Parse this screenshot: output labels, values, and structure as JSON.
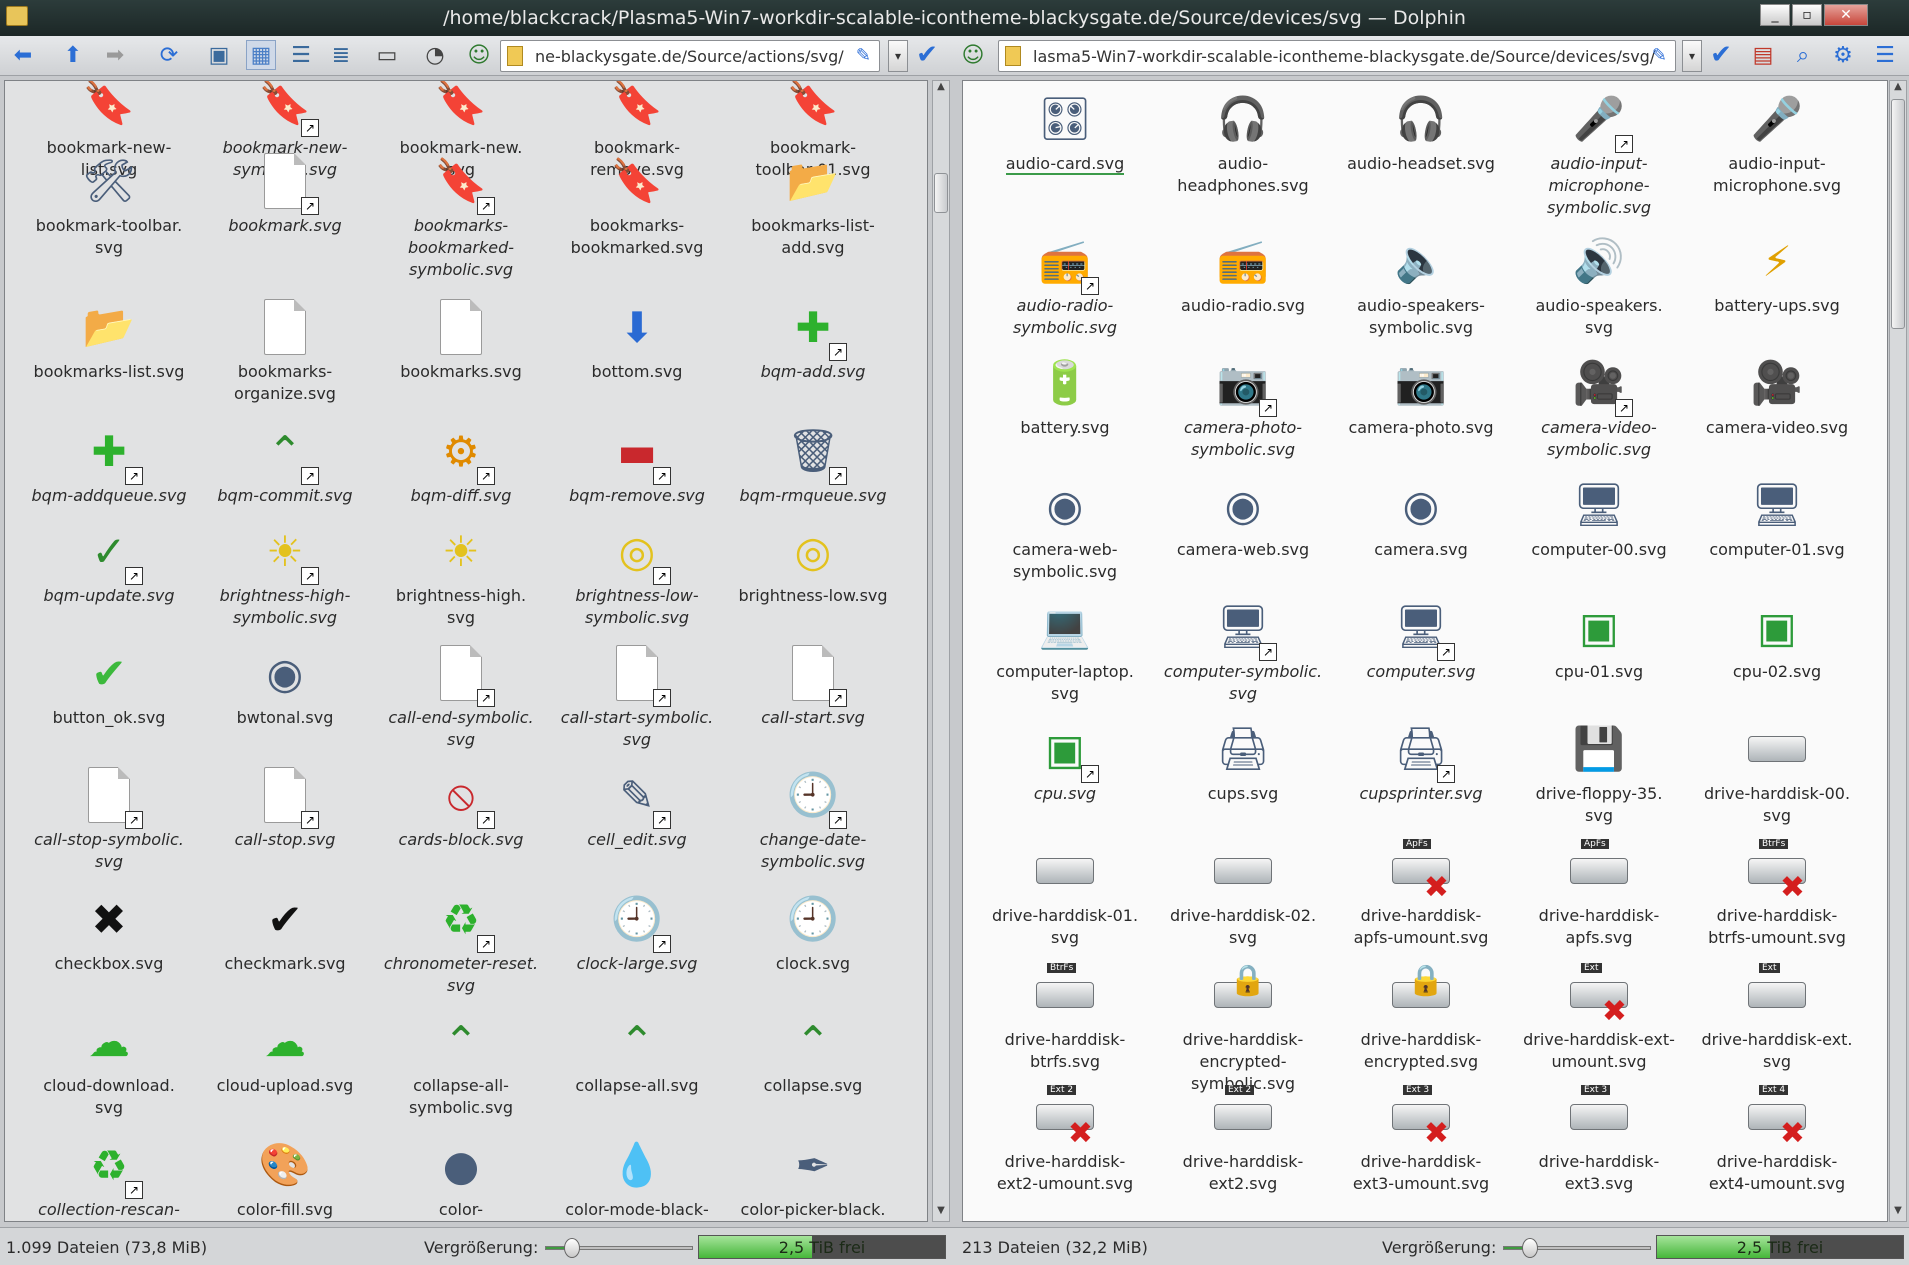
{
  "window": {
    "title": "/home/blackcrack/Plasma5-Win7-workdir-scalable-icontheme-blackysgate.de/Source/devices/svg — Dolphin",
    "buttons": [
      "_",
      "▫",
      "✕"
    ]
  },
  "toolbar": {
    "left_path": "ne-blackysgate.de/Source/actions/svg/",
    "right_path": "lasma5-Win7-workdir-scalable-icontheme-blackysgate.de/Source/devices/svg/"
  },
  "left_pane": {
    "items": [
      {
        "label": "bookmark-new-\nlist.svg",
        "icon": "bookmark-new-list-icon",
        "link": false
      },
      {
        "label": "bookmark-new-\nsymbolic.svg",
        "icon": "bookmark-new-symbolic-icon",
        "link": true
      },
      {
        "label": "bookmark-new.\nsvg",
        "icon": "bookmark-new-icon",
        "link": false
      },
      {
        "label": "bookmark-\nremove.svg",
        "icon": "bookmark-remove-icon",
        "link": false
      },
      {
        "label": "bookmark-\ntoolbar-01.svg",
        "icon": "bookmark-toolbar-icon",
        "link": false
      },
      {
        "label": "bookmark-toolbar.\nsvg",
        "icon": "bookmark-toolbar-tools-icon",
        "link": false
      },
      {
        "label": "bookmark.svg",
        "icon": "bookmark-icon",
        "link": true
      },
      {
        "label": "bookmarks-\nbookmarked-\nsymbolic.svg",
        "icon": "bookmarks-bookmarked-symbolic-icon",
        "link": true
      },
      {
        "label": "bookmarks-\nbookmarked.svg",
        "icon": "bookmarks-bookmarked-icon",
        "link": false
      },
      {
        "label": "bookmarks-list-\nadd.svg",
        "icon": "bookmarks-list-add-icon",
        "link": false
      },
      {
        "label": "bookmarks-list.svg",
        "icon": "bookmarks-list-icon",
        "link": false
      },
      {
        "label": "bookmarks-\norganize.svg",
        "icon": "bookmarks-organize-icon",
        "link": false
      },
      {
        "label": "bookmarks.svg",
        "icon": "bookmarks-icon",
        "link": false
      },
      {
        "label": "bottom.svg",
        "icon": "bottom-icon",
        "link": false
      },
      {
        "label": "bqm-add.svg",
        "icon": "bqm-add-icon",
        "link": true
      },
      {
        "label": "bqm-addqueue.svg",
        "icon": "bqm-addqueue-icon",
        "link": true
      },
      {
        "label": "bqm-commit.svg",
        "icon": "bqm-commit-icon",
        "link": true
      },
      {
        "label": "bqm-diff.svg",
        "icon": "bqm-diff-icon",
        "link": true
      },
      {
        "label": "bqm-remove.svg",
        "icon": "bqm-remove-icon",
        "link": true
      },
      {
        "label": "bqm-rmqueue.svg",
        "icon": "bqm-rmqueue-icon",
        "link": true
      },
      {
        "label": "bqm-update.svg",
        "icon": "bqm-update-icon",
        "link": true
      },
      {
        "label": "brightness-high-\nsymbolic.svg",
        "icon": "brightness-high-symbolic-icon",
        "link": true
      },
      {
        "label": "brightness-high.\nsvg",
        "icon": "brightness-high-icon",
        "link": false
      },
      {
        "label": "brightness-low-\nsymbolic.svg",
        "icon": "brightness-low-symbolic-icon",
        "link": true
      },
      {
        "label": "brightness-low.svg",
        "icon": "brightness-low-icon",
        "link": false
      },
      {
        "label": "button_ok.svg",
        "icon": "button-ok-icon",
        "link": false
      },
      {
        "label": "bwtonal.svg",
        "icon": "bwtonal-icon",
        "link": false
      },
      {
        "label": "call-end-symbolic.\nsvg",
        "icon": "call-end-symbolic-icon",
        "link": true
      },
      {
        "label": "call-start-symbolic.\nsvg",
        "icon": "call-start-symbolic-icon",
        "link": true
      },
      {
        "label": "call-start.svg",
        "icon": "call-start-icon",
        "link": true
      },
      {
        "label": "call-stop-symbolic.\nsvg",
        "icon": "call-stop-symbolic-icon",
        "link": true
      },
      {
        "label": "call-stop.svg",
        "icon": "call-stop-icon",
        "link": true
      },
      {
        "label": "cards-block.svg",
        "icon": "cards-block-icon",
        "link": true
      },
      {
        "label": "cell_edit.svg",
        "icon": "cell-edit-icon",
        "link": true
      },
      {
        "label": "change-date-\nsymbolic.svg",
        "icon": "change-date-symbolic-icon",
        "link": true
      },
      {
        "label": "checkbox.svg",
        "icon": "checkbox-icon",
        "link": false
      },
      {
        "label": "checkmark.svg",
        "icon": "checkmark-icon",
        "link": false
      },
      {
        "label": "chronometer-reset.\nsvg",
        "icon": "chronometer-reset-icon",
        "link": true
      },
      {
        "label": "clock-large.svg",
        "icon": "clock-large-icon",
        "link": true
      },
      {
        "label": "clock.svg",
        "icon": "clock-icon",
        "link": false
      },
      {
        "label": "cloud-download.\nsvg",
        "icon": "cloud-download-icon",
        "link": false
      },
      {
        "label": "cloud-upload.svg",
        "icon": "cloud-upload-icon",
        "link": false
      },
      {
        "label": "collapse-all-\nsymbolic.svg",
        "icon": "collapse-all-symbolic-icon",
        "link": false
      },
      {
        "label": "collapse-all.svg",
        "icon": "collapse-all-icon",
        "link": false
      },
      {
        "label": "collapse.svg",
        "icon": "collapse-icon",
        "link": false
      },
      {
        "label": "collection-rescan-",
        "icon": "collection-rescan-icon",
        "link": true
      },
      {
        "label": "color-fill.svg",
        "icon": "color-fill-icon",
        "link": false
      },
      {
        "label": "color-",
        "icon": "color-icon",
        "link": false
      },
      {
        "label": "color-mode-black-",
        "icon": "color-mode-black-icon",
        "link": false
      },
      {
        "label": "color-picker-black.",
        "icon": "color-picker-black-icon",
        "link": false
      }
    ]
  },
  "right_pane": {
    "items": [
      {
        "label": "audio-card.svg",
        "icon": "audio-card-icon",
        "link": false,
        "selected": true
      },
      {
        "label": "audio-\nheadphones.svg",
        "icon": "audio-headphones-icon",
        "link": false
      },
      {
        "label": "audio-headset.svg",
        "icon": "audio-headset-icon",
        "link": false
      },
      {
        "label": "audio-input-\nmicrophone-\nsymbolic.svg",
        "icon": "microphone-symbolic-icon",
        "link": true
      },
      {
        "label": "audio-input-\nmicrophone.svg",
        "icon": "microphone-icon",
        "link": false
      },
      {
        "label": "audio-radio-\nsymbolic.svg",
        "icon": "audio-radio-symbolic-icon",
        "link": true
      },
      {
        "label": "audio-radio.svg",
        "icon": "audio-radio-icon",
        "link": false
      },
      {
        "label": "audio-speakers-\nsymbolic.svg",
        "icon": "audio-speakers-symbolic-icon",
        "link": false
      },
      {
        "label": "audio-speakers.\nsvg",
        "icon": "audio-speakers-icon",
        "link": false
      },
      {
        "label": "battery-ups.svg",
        "icon": "battery-ups-icon",
        "link": false
      },
      {
        "label": "battery.svg",
        "icon": "battery-icon",
        "link": false
      },
      {
        "label": "camera-photo-\nsymbolic.svg",
        "icon": "camera-photo-symbolic-icon",
        "link": true
      },
      {
        "label": "camera-photo.svg",
        "icon": "camera-photo-icon",
        "link": false
      },
      {
        "label": "camera-video-\nsymbolic.svg",
        "icon": "camera-video-symbolic-icon",
        "link": true
      },
      {
        "label": "camera-video.svg",
        "icon": "camera-video-icon",
        "link": false
      },
      {
        "label": "camera-web-\nsymbolic.svg",
        "icon": "camera-web-symbolic-icon",
        "link": false
      },
      {
        "label": "camera-web.svg",
        "icon": "camera-web-icon",
        "link": false
      },
      {
        "label": "camera.svg",
        "icon": "camera-icon",
        "link": false
      },
      {
        "label": "computer-00.svg",
        "icon": "computer-00-icon",
        "link": false
      },
      {
        "label": "computer-01.svg",
        "icon": "computer-01-icon",
        "link": false
      },
      {
        "label": "computer-laptop.\nsvg",
        "icon": "computer-laptop-icon",
        "link": false
      },
      {
        "label": "computer-symbolic.\nsvg",
        "icon": "computer-symbolic-icon",
        "link": true
      },
      {
        "label": "computer.svg",
        "icon": "computer-icon",
        "link": true
      },
      {
        "label": "cpu-01.svg",
        "icon": "cpu-01-icon",
        "link": false
      },
      {
        "label": "cpu-02.svg",
        "icon": "cpu-02-icon",
        "link": false
      },
      {
        "label": "cpu.svg",
        "icon": "cpu-icon",
        "link": true
      },
      {
        "label": "cups.svg",
        "icon": "cups-icon",
        "link": false
      },
      {
        "label": "cupsprinter.svg",
        "icon": "cupsprinter-icon",
        "link": true
      },
      {
        "label": "drive-floppy-35.\nsvg",
        "icon": "drive-floppy-icon",
        "link": false
      },
      {
        "label": "drive-harddisk-00.\nsvg",
        "icon": "drive-harddisk-00-icon",
        "link": false
      },
      {
        "label": "drive-harddisk-01.\nsvg",
        "icon": "drive-harddisk-01-icon",
        "link": false
      },
      {
        "label": "drive-harddisk-02.\nsvg",
        "icon": "drive-harddisk-02-icon",
        "link": false
      },
      {
        "label": "drive-harddisk-\napfs-umount.svg",
        "icon": "drive-harddisk-apfs-umount-icon",
        "link": false,
        "tag": "ApFs",
        "redx": true
      },
      {
        "label": "drive-harddisk-\napfs.svg",
        "icon": "drive-harddisk-apfs-icon",
        "link": false,
        "tag": "ApFs"
      },
      {
        "label": "drive-harddisk-\nbtrfs-umount.svg",
        "icon": "drive-harddisk-btrfs-umount-icon",
        "link": false,
        "tag": "BtrFs",
        "redx": true
      },
      {
        "label": "drive-harddisk-\nbtrfs.svg",
        "icon": "drive-harddisk-btrfs-icon",
        "link": false,
        "tag": "BtrFs"
      },
      {
        "label": "drive-harddisk-\nencrypted-\nsymbolic.svg",
        "icon": "drive-harddisk-encrypted-symbolic-icon",
        "link": false
      },
      {
        "label": "drive-harddisk-\nencrypted.svg",
        "icon": "drive-harddisk-encrypted-icon",
        "link": false
      },
      {
        "label": "drive-harddisk-ext-\numount.svg",
        "icon": "drive-harddisk-ext-umount-icon",
        "link": false,
        "tag": "Ext",
        "redx": true
      },
      {
        "label": "drive-harddisk-ext.\nsvg",
        "icon": "drive-harddisk-ext-icon",
        "link": false,
        "tag": "Ext"
      },
      {
        "label": "drive-harddisk-\next2-umount.svg",
        "icon": "drive-harddisk-ext2-umount-icon",
        "link": false,
        "tag": "Ext 2",
        "redx": true
      },
      {
        "label": "drive-harddisk-\next2.svg",
        "icon": "drive-harddisk-ext2-icon",
        "link": false,
        "tag": "Ext 2"
      },
      {
        "label": "drive-harddisk-\next3-umount.svg",
        "icon": "drive-harddisk-ext3-umount-icon",
        "link": false,
        "tag": "Ext 3",
        "redx": true
      },
      {
        "label": "drive-harddisk-\next3.svg",
        "icon": "drive-harddisk-ext3-icon",
        "link": false,
        "tag": "Ext 3"
      },
      {
        "label": "drive-harddisk-\next4-umount.svg",
        "icon": "drive-harddisk-ext4-umount-icon",
        "link": false,
        "tag": "Ext 4",
        "redx": true
      }
    ]
  },
  "status": {
    "left_count": "1.099 Dateien (73,8 MiB)",
    "zoom_label": "Vergrößerung:",
    "left_space": "2,5 TiB frei",
    "right_count": "213 Dateien (32,2 MiB)",
    "right_space": "2,5 TiB frei",
    "zoom_level": 0.18,
    "space_used": 0.46
  }
}
